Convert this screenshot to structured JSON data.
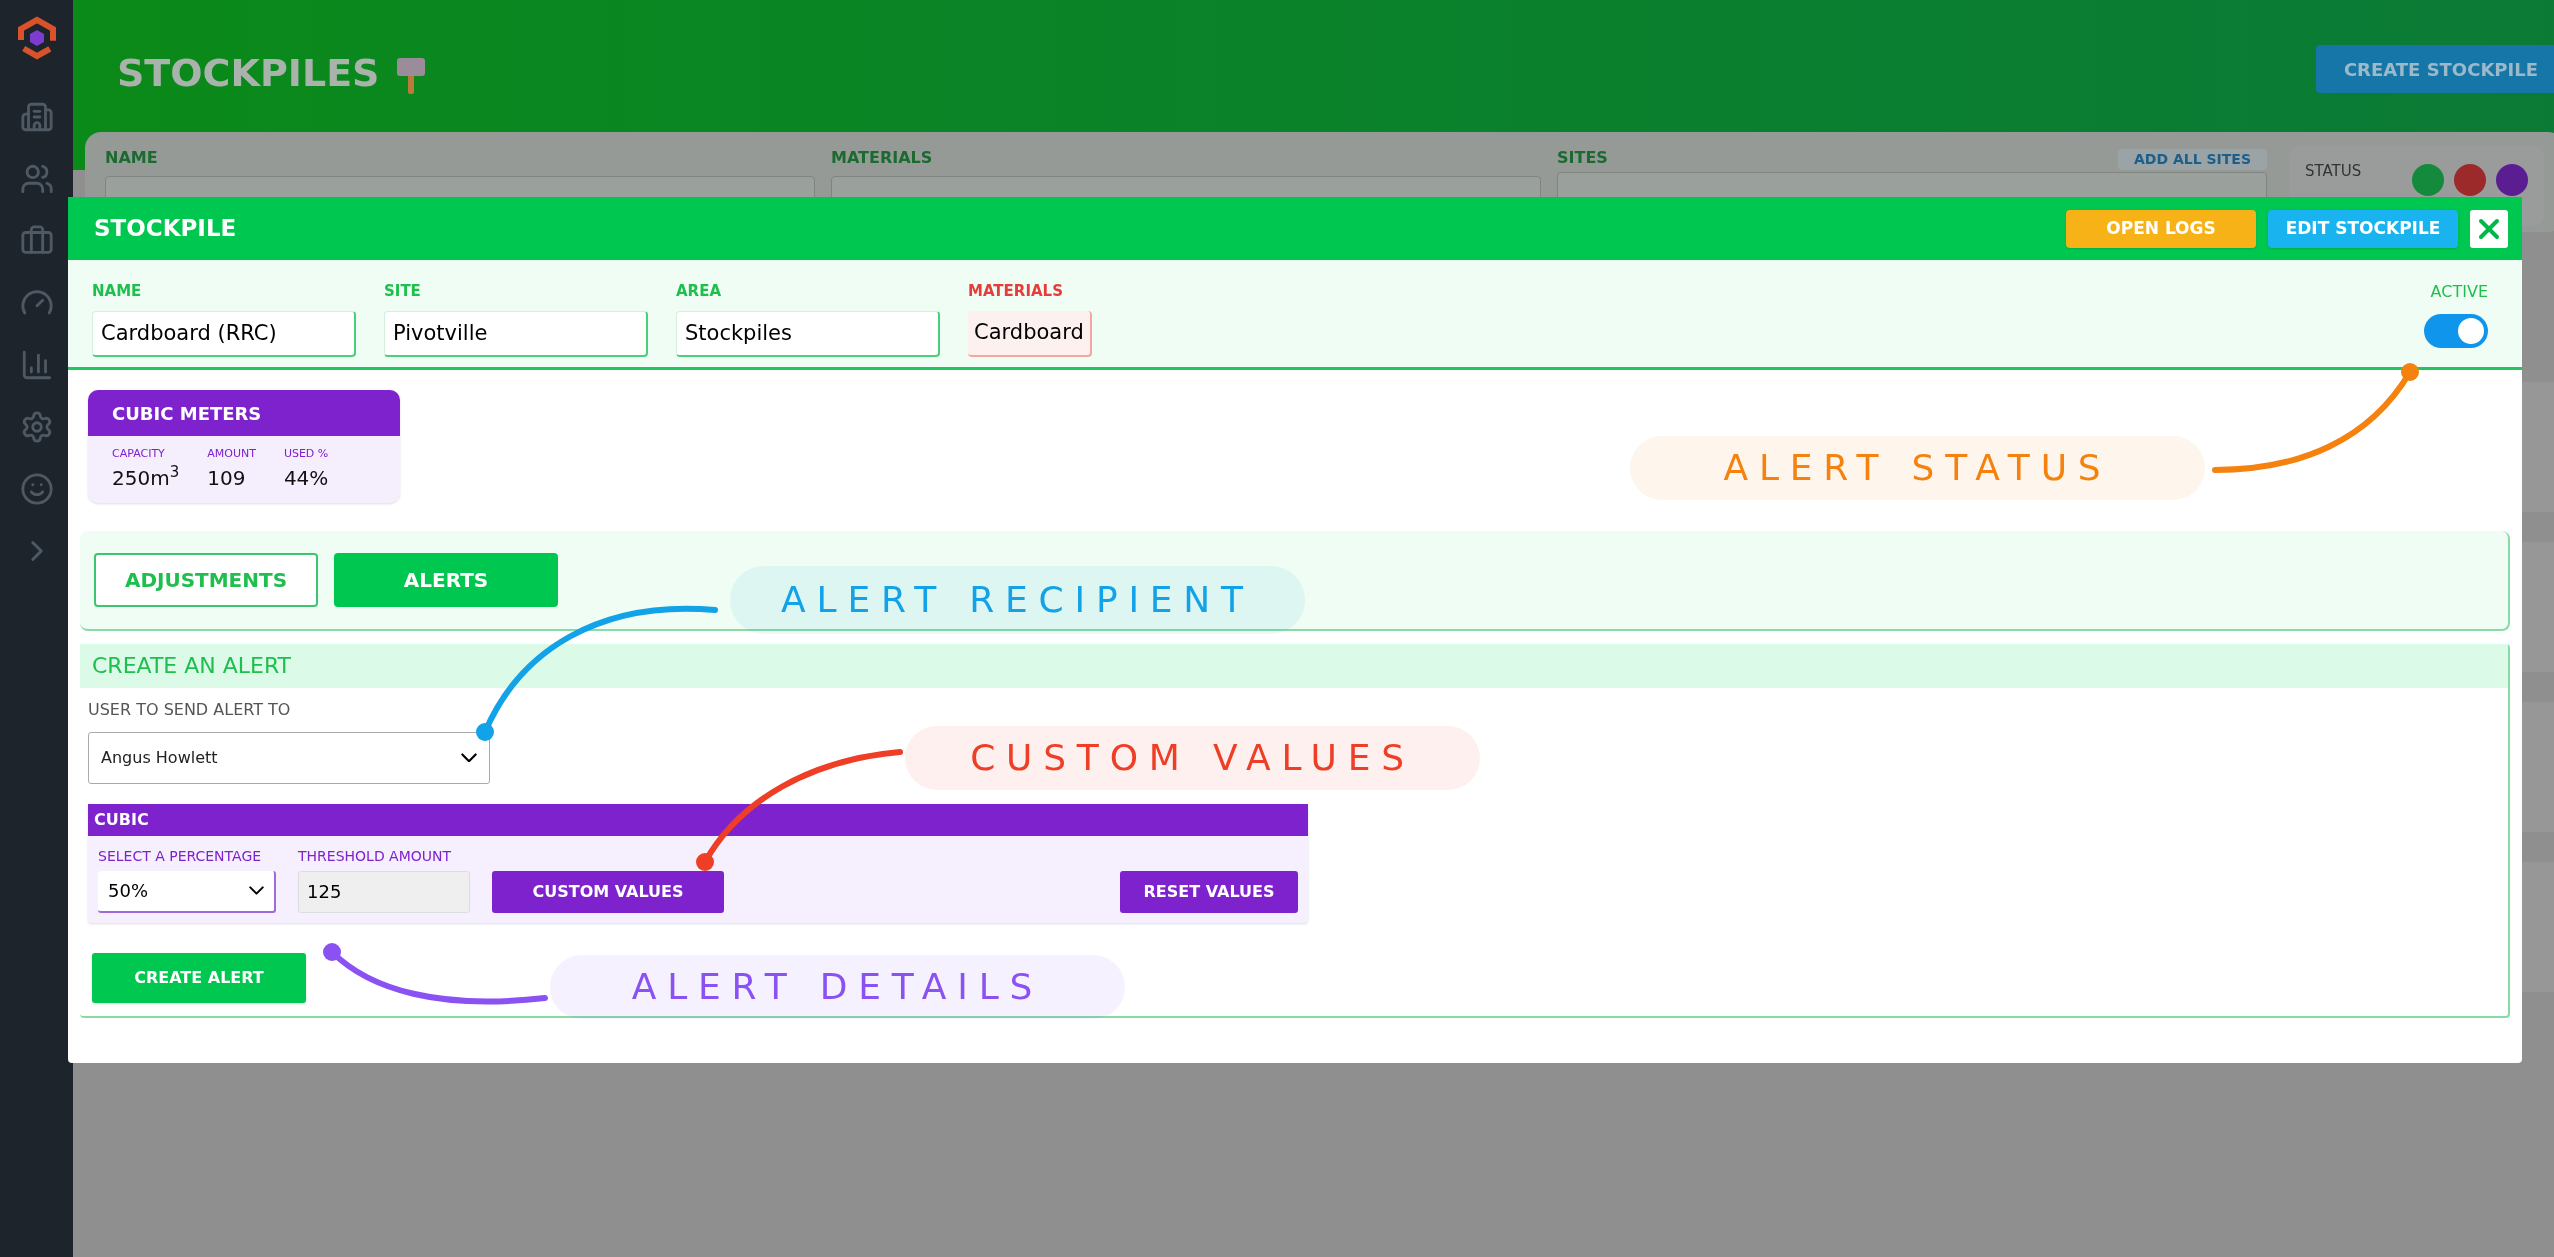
{
  "page": {
    "title": "STOCKPILES",
    "create_button": "CREATE STOCKPILE",
    "filters": {
      "name_label": "NAME",
      "materials_label": "MATERIALS",
      "sites_label": "SITES",
      "add_all_sites": "ADD ALL SITES",
      "status_label": "STATUS",
      "status_dots": [
        {
          "color": "#138a3c"
        },
        {
          "color": "#9c2a2a"
        },
        {
          "color": "#5b1e92"
        }
      ]
    }
  },
  "modal": {
    "title": "STOCKPILE",
    "buttons": [
      {
        "label": "OPEN LOGS",
        "kind": "logs"
      },
      {
        "label": "EDIT STOCKPILE",
        "kind": "edit"
      }
    ],
    "fields": [
      {
        "label": "NAME",
        "value": "Cardboard (RRC)",
        "kind": "text"
      },
      {
        "label": "SITE",
        "value": "Pivotville",
        "kind": "text"
      },
      {
        "label": "AREA",
        "value": "Stockpiles",
        "kind": "text"
      },
      {
        "label": "MATERIALS",
        "value": "Cardboard",
        "kind": "tag"
      }
    ],
    "active": {
      "label": "ACTIVE",
      "on": true
    },
    "cubic_card": {
      "title": "CUBIC METERS",
      "stats": [
        {
          "label": "CAPACITY",
          "value": "250m$^{3}$"
        },
        {
          "label": "AMOUNT",
          "value": "109"
        },
        {
          "label": "USED %",
          "value": "44%"
        }
      ]
    },
    "tabs": [
      {
        "label": "ADJUSTMENTS",
        "selected": false
      },
      {
        "label": "ALERTS",
        "selected": true
      }
    ],
    "create_alert": {
      "title": "CREATE AN ALERT",
      "user_label": "USER TO SEND ALERT TO",
      "user_value": "Angus Howlett",
      "cubic": {
        "title": "CUBIC",
        "percentage_label": "SELECT A PERCENTAGE",
        "percentage_value": "50%",
        "threshold_label": "THRESHOLD AMOUNT",
        "threshold_value": "125",
        "custom_button": "CUSTOM VALUES",
        "reset_button": "RESET VALUES"
      },
      "submit": "CREATE ALERT"
    }
  },
  "annotations": [
    {
      "text": "ALERT STATUS",
      "color": "#f5820f"
    },
    {
      "text": "ALERT RECIPIENT",
      "color": "#12a2e8"
    },
    {
      "text": "CUSTOM VALUES",
      "color": "#ef3e26"
    },
    {
      "text": "ALERT DETAILS",
      "color": "#8a52f2"
    }
  ]
}
